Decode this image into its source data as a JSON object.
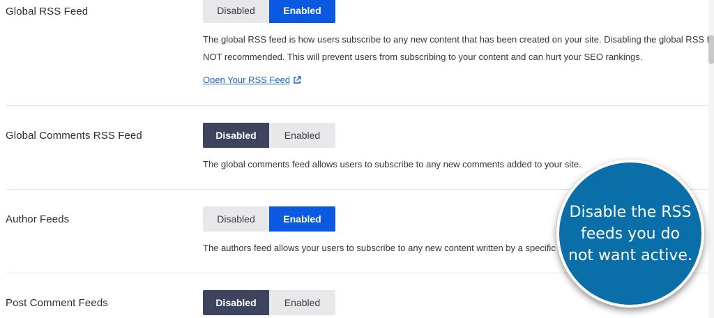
{
  "settings": [
    {
      "label": "Global RSS Feed",
      "disabled_label": "Disabled",
      "enabled_label": "Enabled",
      "state": "enabled",
      "description_lines": [
        "The global RSS feed is how users subscribe to any new content that has been created on your site. Disabling the global RSS feed is",
        "NOT recommended. This will prevent users from subscribing to your content and can hurt your SEO rankings."
      ],
      "link_text": "Open Your RSS Feed",
      "link_icon": "external-link-icon"
    },
    {
      "label": "Global Comments RSS Feed",
      "disabled_label": "Disabled",
      "enabled_label": "Enabled",
      "state": "disabled",
      "description_lines": [
        "The global comments feed allows users to subscribe to any new comments added to your site."
      ]
    },
    {
      "label": "Author Feeds",
      "disabled_label": "Disabled",
      "enabled_label": "Enabled",
      "state": "enabled",
      "description_lines": [
        "The authors feed allows your users to subscribe to any new content written by a specific author."
      ]
    },
    {
      "label": "Post Comment Feeds",
      "disabled_label": "Disabled",
      "enabled_label": "Enabled",
      "state": "disabled"
    }
  ],
  "callout": {
    "text": "Disable the RSS feeds you do not want active."
  },
  "colors": {
    "enabled_active": "#0a59e0",
    "disabled_active": "#3f445e",
    "inactive": "#e8e8ea",
    "callout_bg": "#0a6ea8",
    "link": "#1d63c9"
  }
}
